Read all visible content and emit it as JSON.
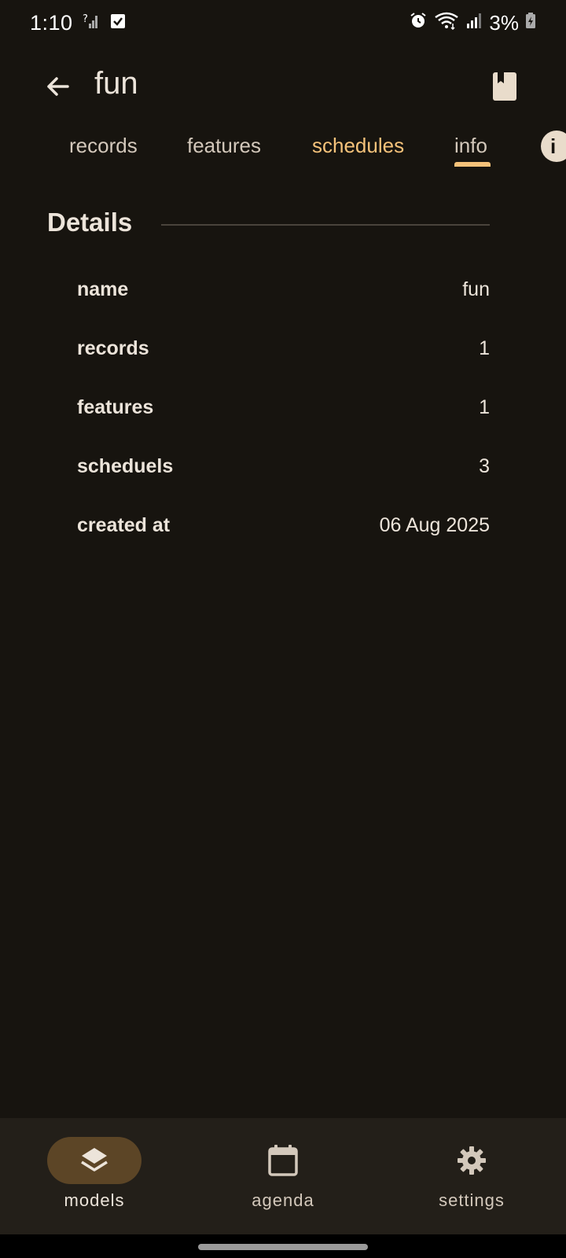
{
  "status_bar": {
    "time": "1:10",
    "battery": "3%"
  },
  "app_bar": {
    "title": "fun"
  },
  "tabs": [
    {
      "label": "records"
    },
    {
      "label": "features"
    },
    {
      "label": "schedules"
    },
    {
      "label": "info"
    }
  ],
  "details": {
    "header": "Details",
    "rows": [
      {
        "label": "name",
        "value": "fun"
      },
      {
        "label": "records",
        "value": "1"
      },
      {
        "label": "features",
        "value": "1"
      },
      {
        "label": "scheduels",
        "value": "3"
      },
      {
        "label": "created at",
        "value": "06 Aug 2025"
      }
    ]
  },
  "bottom_nav": {
    "items": [
      {
        "label": "models",
        "icon": "layers-icon",
        "active": true
      },
      {
        "label": "agenda",
        "icon": "calendar-icon",
        "active": false
      },
      {
        "label": "settings",
        "icon": "gear-icon",
        "active": false
      }
    ]
  },
  "colors": {
    "background": "#17140f",
    "accent": "#f5c27a",
    "nav_background": "#231f19",
    "active_pill": "#5c4526"
  }
}
